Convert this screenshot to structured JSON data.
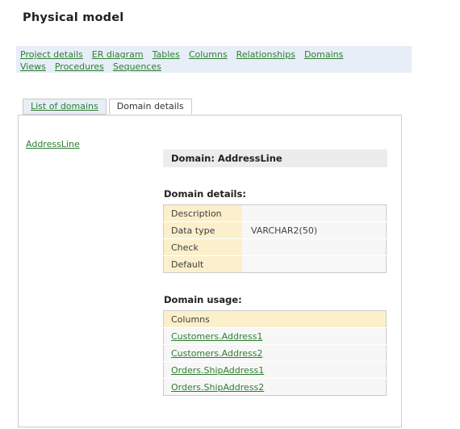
{
  "page": {
    "title": "Physical model"
  },
  "nav": {
    "rows": [
      [
        {
          "label": "Project details"
        },
        {
          "label": "ER diagram"
        },
        {
          "label": "Tables"
        },
        {
          "label": "Columns"
        },
        {
          "label": "Relationships"
        },
        {
          "label": "Domains"
        }
      ],
      [
        {
          "label": "Views"
        },
        {
          "label": "Procedures"
        },
        {
          "label": "Sequences"
        }
      ]
    ]
  },
  "tabs": [
    {
      "label": "List of domains",
      "active": false
    },
    {
      "label": "Domain details",
      "active": true
    }
  ],
  "domain_list": {
    "items": [
      {
        "label": "AddressLine"
      }
    ]
  },
  "detail": {
    "header": "Domain: AddressLine",
    "details_heading": "Domain details:",
    "details_rows": [
      {
        "label": "Description",
        "value": ""
      },
      {
        "label": "Data type",
        "value": "VARCHAR2(50)"
      },
      {
        "label": "Check",
        "value": ""
      },
      {
        "label": "Default",
        "value": ""
      }
    ],
    "usage_heading": "Domain usage:",
    "usage_column_header": "Columns",
    "usage_rows": [
      {
        "label": "Customers.Address1"
      },
      {
        "label": "Customers.Address2"
      },
      {
        "label": "Orders.ShipAddress1"
      },
      {
        "label": "Orders.ShipAddress2"
      }
    ]
  },
  "colors": {
    "link_green": "#2f7d32",
    "nav_background": "#e7eef8",
    "table_label_cream": "#fcf0cc",
    "table_value_gray": "#f7f7f7",
    "header_bar_gray": "#ececec",
    "panel_border": "#cccccc"
  }
}
